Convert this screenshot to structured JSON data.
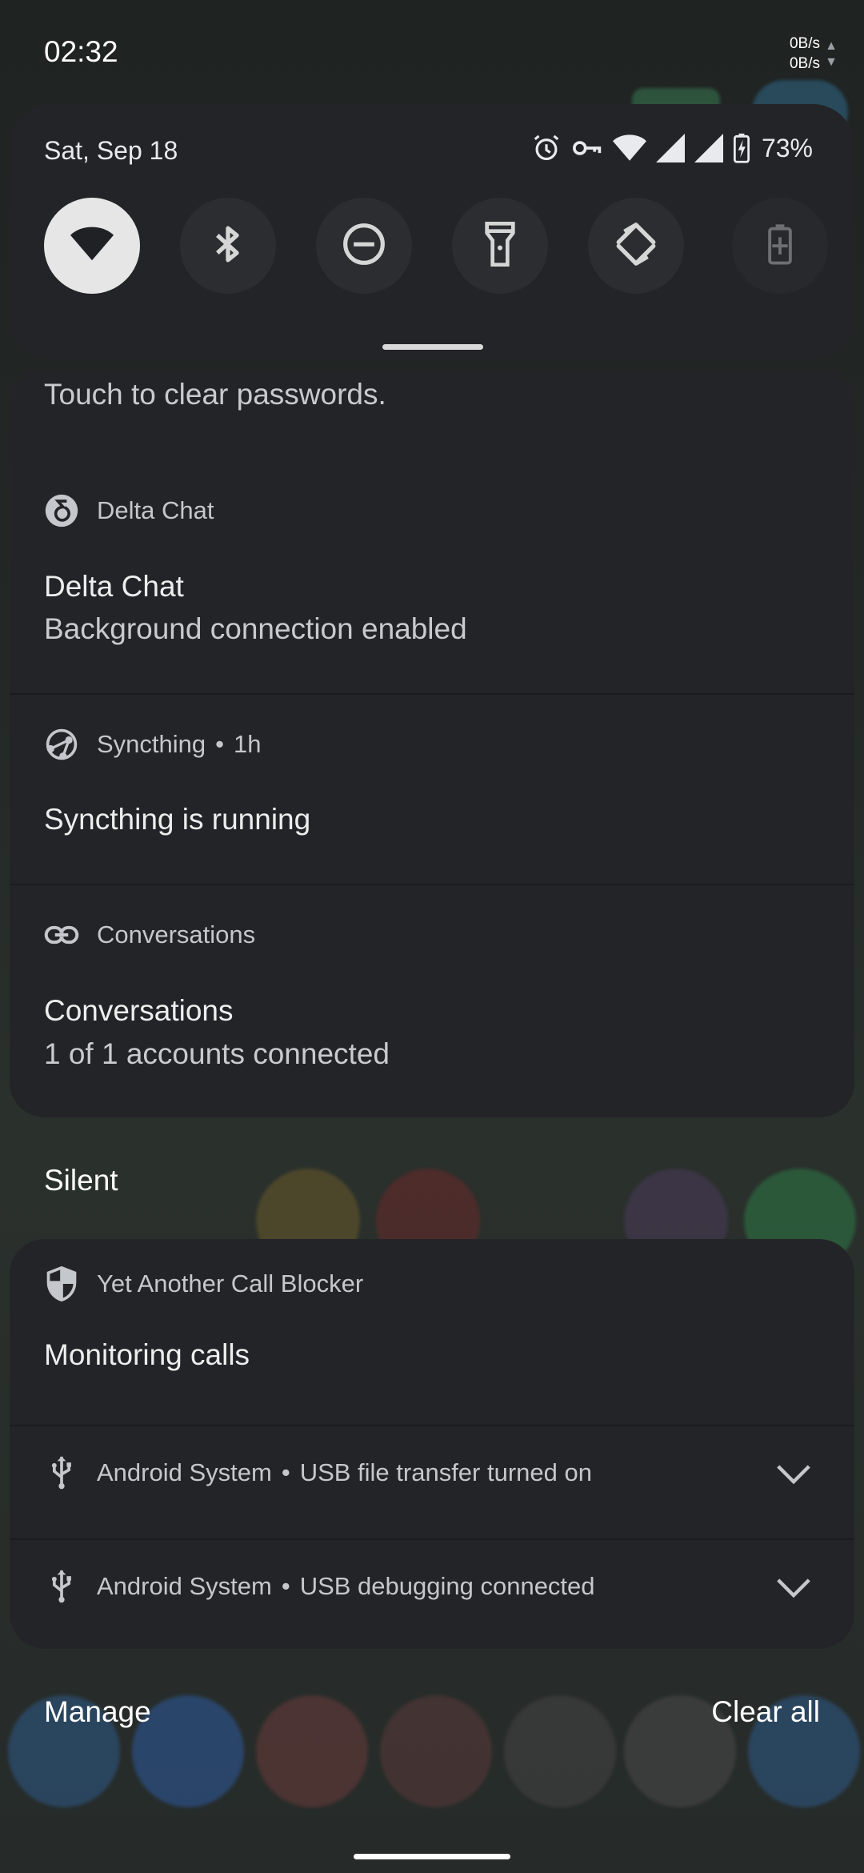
{
  "status_bar": {
    "time": "02:32",
    "net_up": "0B/s",
    "net_down": "0B/s"
  },
  "quick_settings": {
    "date": "Sat, Sep 18",
    "battery_percent": "73%",
    "status_icons": [
      "alarm-icon",
      "vpn-key-icon",
      "wifi-icon",
      "signal-icon",
      "signal-icon",
      "battery-charging-icon"
    ],
    "tiles": [
      {
        "name": "wifi",
        "icon": "wifi-icon",
        "active": true
      },
      {
        "name": "bluetooth",
        "icon": "bluetooth-icon",
        "active": false
      },
      {
        "name": "do-not-disturb",
        "icon": "do-not-disturb-icon",
        "active": false
      },
      {
        "name": "flashlight",
        "icon": "flashlight-icon",
        "active": false
      },
      {
        "name": "auto-rotate",
        "icon": "auto-rotate-icon",
        "active": false
      },
      {
        "name": "battery-saver",
        "icon": "battery-saver-icon",
        "active": false
      }
    ]
  },
  "notifications": {
    "partial": {
      "text": "Touch to clear passwords."
    },
    "delta_chat": {
      "app": "Delta Chat",
      "title": "Delta Chat",
      "text": "Background connection enabled"
    },
    "syncthing": {
      "app": "Syncthing",
      "time": "1h",
      "title": "Syncthing is running"
    },
    "conversations": {
      "app": "Conversations",
      "title": "Conversations",
      "text": "1 of 1 accounts connected"
    }
  },
  "silent_section": {
    "label": "Silent",
    "call_blocker": {
      "app": "Yet Another Call Blocker",
      "title": "Monitoring calls"
    },
    "usb_transfer": {
      "app": "Android System",
      "text": "USB file transfer turned on"
    },
    "usb_debug": {
      "app": "Android System",
      "text": "USB debugging connected"
    }
  },
  "footer": {
    "manage": "Manage",
    "clear_all": "Clear all"
  },
  "colors": {
    "panel": "#232428",
    "tile_on": "#e6e6e6",
    "tile_off": "#2b2d31"
  }
}
